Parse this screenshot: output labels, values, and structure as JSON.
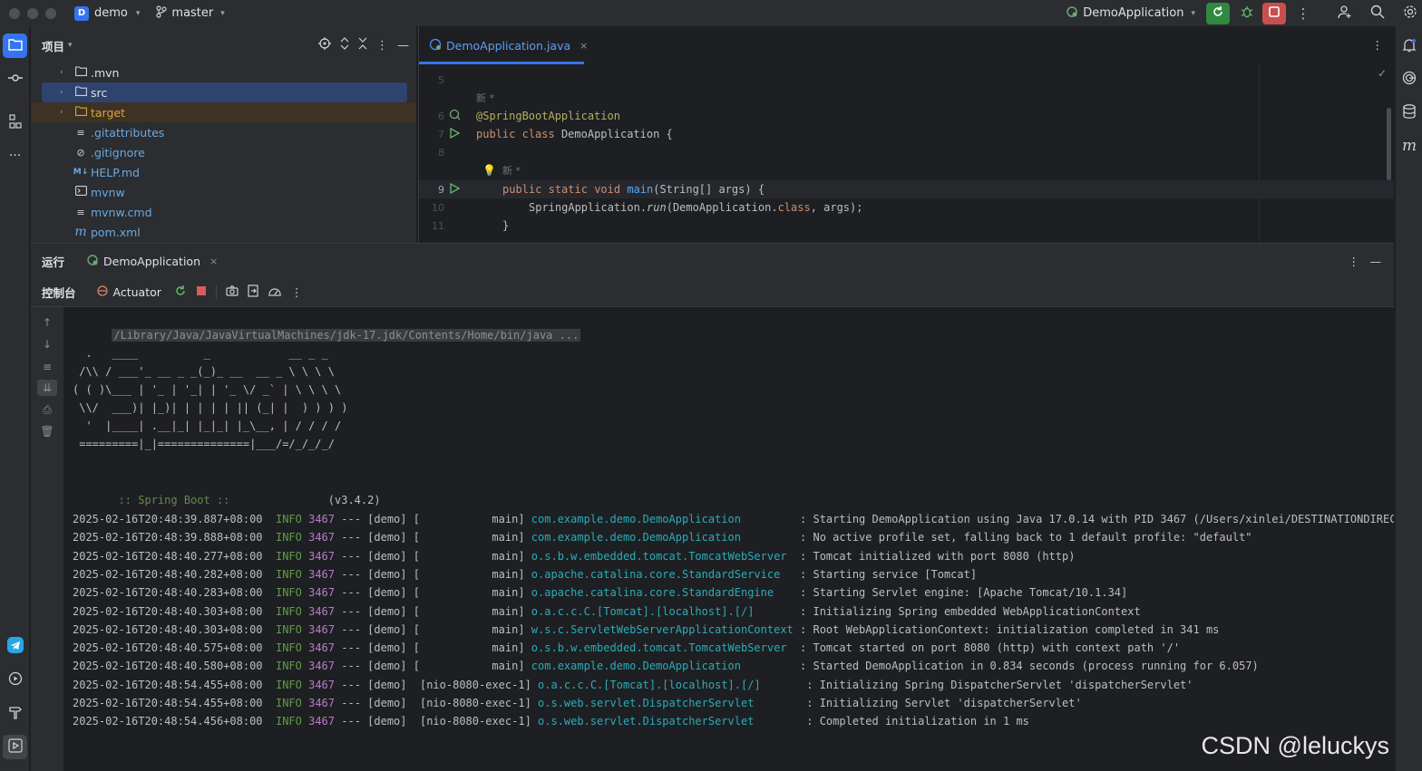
{
  "titlebar": {
    "project_badge": "D",
    "project_name": "demo",
    "branch": "master",
    "run_config": "DemoApplication"
  },
  "left_toolbar": {
    "icons": [
      "folder-icon",
      "commit-icon",
      "structure-icon",
      "more-icon",
      "telegram-icon",
      "services-icon",
      "build-icon",
      "run-icon"
    ]
  },
  "right_toolbar": {
    "icons": [
      "notifications-icon",
      "ai-assistant-icon",
      "database-icon",
      "maven-icon"
    ]
  },
  "project_panel": {
    "title": "项目",
    "items": [
      {
        "label": ".mvn",
        "type": "folder",
        "expandable": true
      },
      {
        "label": "src",
        "type": "folder",
        "expandable": true,
        "selected": true
      },
      {
        "label": "target",
        "type": "folder",
        "expandable": true,
        "excluded": true
      },
      {
        "label": ".gitattributes",
        "type": "text"
      },
      {
        "label": ".gitignore",
        "type": "ignore"
      },
      {
        "label": "HELP.md",
        "type": "markdown",
        "icon_text": "M↓"
      },
      {
        "label": "mvnw",
        "type": "script"
      },
      {
        "label": "mvnw.cmd",
        "type": "text"
      },
      {
        "label": "pom.xml",
        "type": "maven",
        "icon_text": "m"
      }
    ]
  },
  "editor": {
    "tab_label": "DemoApplication.java",
    "hint_new": "新 *",
    "lines": {
      "n5": "5",
      "n6": "6",
      "n7": "7",
      "n8": "8",
      "n9": "9",
      "n10": "10",
      "n11": "11",
      "l6_annotation": "@SpringBootApplication",
      "l7_kw1": "public",
      "l7_kw2": "class",
      "l7_name": "DemoApplication {",
      "l9_kw1": "public",
      "l9_kw2": "static",
      "l9_kw3": "void",
      "l9_fn": "main",
      "l9_rest": "(String[] args) {",
      "l10_a": "SpringApplication.",
      "l10_fn": "run",
      "l10_b": "(DemoApplication.",
      "l10_kw": "class",
      "l10_c": ", args);",
      "l11": "}"
    }
  },
  "run_panel": {
    "title": "运行",
    "tab_label": "DemoApplication",
    "console_tab": "控制台",
    "actuator_tab": "Actuator"
  },
  "console": {
    "command": "/Library/Java/JavaVirtualMachines/jdk-17.jdk/Contents/Home/bin/java ...",
    "banner": [
      "  .   ____          _            __ _ _",
      " /\\\\ / ___'_ __ _ _(_)_ __  __ _ \\ \\ \\ \\",
      "( ( )\\___ | '_ | '_| | '_ \\/ _` | \\ \\ \\ \\",
      " \\\\/  ___)| |_)| | | | | || (_| |  ) ) ) )",
      "  '  |____| .__|_| |_|_| |_\\__, | / / / /",
      " =========|_|==============|___/=/_/_/_/"
    ],
    "spring_boot_label": " :: Spring Boot :: ",
    "spring_boot_version": "              (v3.4.2)",
    "logs": [
      {
        "ts": "2025-02-16T20:48:39.887+08:00",
        "level": "INFO",
        "pid": "3467",
        "app": "--- [demo] [",
        "thread": "          main]",
        "logger": "com.example.demo.DemoApplication        ",
        "msg": ": Starting DemoApplication using Java 17.0.14 with PID 3467 (/Users/xinlei/DESTINATIONDIRECT"
      },
      {
        "ts": "2025-02-16T20:48:39.888+08:00",
        "level": "INFO",
        "pid": "3467",
        "app": "--- [demo] [",
        "thread": "          main]",
        "logger": "com.example.demo.DemoApplication        ",
        "msg": ": No active profile set, falling back to 1 default profile: \"default\""
      },
      {
        "ts": "2025-02-16T20:48:40.277+08:00",
        "level": "INFO",
        "pid": "3467",
        "app": "--- [demo] [",
        "thread": "          main]",
        "logger": "o.s.b.w.embedded.tomcat.TomcatWebServer ",
        "msg": ": Tomcat initialized with port 8080 (http)"
      },
      {
        "ts": "2025-02-16T20:48:40.282+08:00",
        "level": "INFO",
        "pid": "3467",
        "app": "--- [demo] [",
        "thread": "          main]",
        "logger": "o.apache.catalina.core.StandardService  ",
        "msg": ": Starting service [Tomcat]"
      },
      {
        "ts": "2025-02-16T20:48:40.283+08:00",
        "level": "INFO",
        "pid": "3467",
        "app": "--- [demo] [",
        "thread": "          main]",
        "logger": "o.apache.catalina.core.StandardEngine   ",
        "msg": ": Starting Servlet engine: [Apache Tomcat/10.1.34]"
      },
      {
        "ts": "2025-02-16T20:48:40.303+08:00",
        "level": "INFO",
        "pid": "3467",
        "app": "--- [demo] [",
        "thread": "          main]",
        "logger": "o.a.c.c.C.[Tomcat].[localhost].[/]      ",
        "msg": ": Initializing Spring embedded WebApplicationContext"
      },
      {
        "ts": "2025-02-16T20:48:40.303+08:00",
        "level": "INFO",
        "pid": "3467",
        "app": "--- [demo] [",
        "thread": "          main]",
        "logger": "w.s.c.ServletWebServerApplicationContext",
        "msg": ": Root WebApplicationContext: initialization completed in 341 ms"
      },
      {
        "ts": "2025-02-16T20:48:40.575+08:00",
        "level": "INFO",
        "pid": "3467",
        "app": "--- [demo] [",
        "thread": "          main]",
        "logger": "o.s.b.w.embedded.tomcat.TomcatWebServer ",
        "msg": ": Tomcat started on port 8080 (http) with context path '/'"
      },
      {
        "ts": "2025-02-16T20:48:40.580+08:00",
        "level": "INFO",
        "pid": "3467",
        "app": "--- [demo] [",
        "thread": "          main]",
        "logger": "com.example.demo.DemoApplication        ",
        "msg": ": Started DemoApplication in 0.834 seconds (process running for 6.057)"
      },
      {
        "ts": "2025-02-16T20:48:54.455+08:00",
        "level": "INFO",
        "pid": "3467",
        "app": "--- [demo] ",
        "thread": "[nio-8080-exec-1]",
        "logger": "o.a.c.c.C.[Tomcat].[localhost].[/]      ",
        "msg": ": Initializing Spring DispatcherServlet 'dispatcherServlet'"
      },
      {
        "ts": "2025-02-16T20:48:54.455+08:00",
        "level": "INFO",
        "pid": "3467",
        "app": "--- [demo] ",
        "thread": "[nio-8080-exec-1]",
        "logger": "o.s.web.servlet.DispatcherServlet       ",
        "msg": ": Initializing Servlet 'dispatcherServlet'"
      },
      {
        "ts": "2025-02-16T20:48:54.456+08:00",
        "level": "INFO",
        "pid": "3467",
        "app": "--- [demo] ",
        "thread": "[nio-8080-exec-1]",
        "logger": "o.s.web.servlet.DispatcherServlet       ",
        "msg": ": Completed initialization in 1 ms"
      }
    ]
  },
  "watermark": "CSDN @leluckys",
  "colors": {
    "accent": "#3574f0",
    "run_green": "#2f8a3f",
    "stop_red": "#c94f4f",
    "logger_cyan": "#2aacb8",
    "info_green": "#5f9b48",
    "pid_purple": "#b77cc8"
  }
}
